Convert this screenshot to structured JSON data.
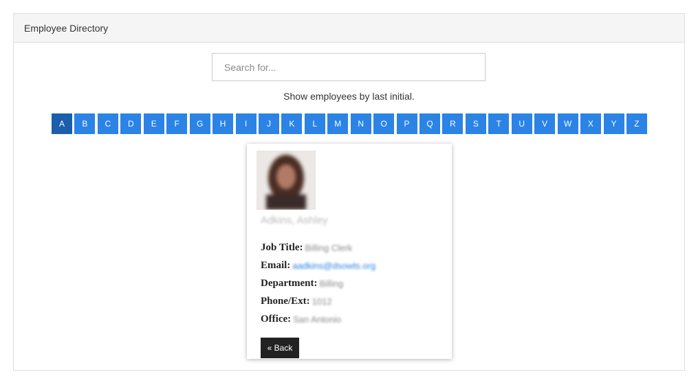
{
  "panel": {
    "title": "Employee Directory"
  },
  "search": {
    "placeholder": "Search for..."
  },
  "hint": "Show employees by last initial.",
  "letters": [
    "A",
    "B",
    "C",
    "D",
    "E",
    "F",
    "G",
    "H",
    "I",
    "J",
    "K",
    "L",
    "M",
    "N",
    "O",
    "P",
    "Q",
    "R",
    "S",
    "T",
    "U",
    "V",
    "W",
    "X",
    "Y",
    "Z"
  ],
  "active_letter": "A",
  "employee": {
    "name": "Adkins, Ashley",
    "fields": [
      {
        "label": "Job Title:",
        "value": "Billing Clerk",
        "is_link": false
      },
      {
        "label": "Email:",
        "value": "aadkins@dsowts.org",
        "is_link": true
      },
      {
        "label": "Department:",
        "value": "Billing",
        "is_link": false
      },
      {
        "label": "Phone/Ext:",
        "value": "1012",
        "is_link": false
      },
      {
        "label": "Office:",
        "value": "San Antonio",
        "is_link": false
      }
    ],
    "back_label": "« Back"
  },
  "colors": {
    "letter_button": "#2b83e6",
    "letter_button_active": "#1a5eac",
    "back_button": "#222222"
  }
}
